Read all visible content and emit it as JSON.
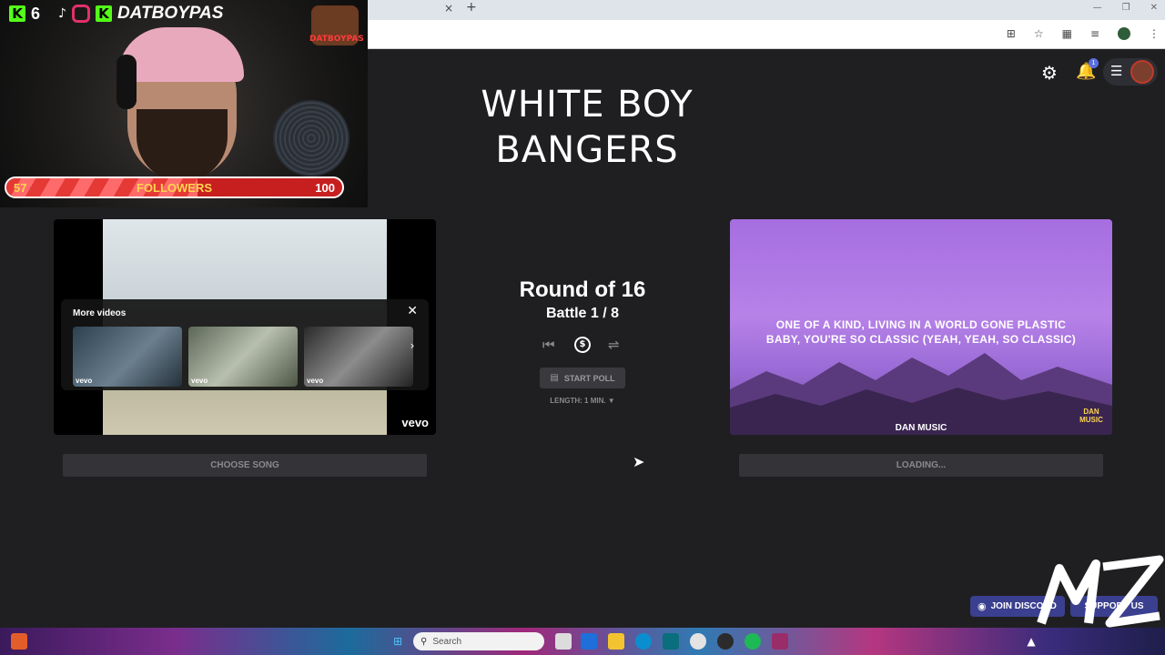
{
  "stream_overlay": {
    "kick_count": "6",
    "handle": "DATBOYPAS",
    "channel_logo_text": "DATBOYPAS",
    "followers": {
      "current": "57",
      "label": "FOLLOWERS",
      "goal": "100",
      "progress": 0.57
    }
  },
  "browser": {
    "tab_close": "×",
    "new_tab": "+"
  },
  "app": {
    "title_line1": "WHITE BOY",
    "title_line2": "BANGERS",
    "notification_count": "1",
    "round": "Round of 16",
    "battle": "Battle 1 / 8",
    "start_poll_label": "START POLL",
    "length_label": "LENGTH: 1 MIN. ▼"
  },
  "left_video": {
    "more_videos_title": "More videos",
    "thumb_labels": [
      "vevo",
      "vevo",
      "vevo"
    ],
    "watermark": "vevo"
  },
  "right_video": {
    "lyric_line1": "ONE OF A KIND, LIVING IN A WORLD GONE PLASTIC",
    "lyric_line2": "BABY, YOU'RE SO CLASSIC (YEAH, YEAH, SO CLASSIC)",
    "channel_name": "DAN MUSIC",
    "corner_logo": "DAN MUSIC"
  },
  "buttons": {
    "choose_song": "CHOOSE SONG",
    "loading": "LOADING..."
  },
  "footer": {
    "join_discord": "JOIN DISCORD",
    "support_us": "SUPPORT US"
  },
  "taskbar": {
    "search_placeholder": "Search"
  }
}
